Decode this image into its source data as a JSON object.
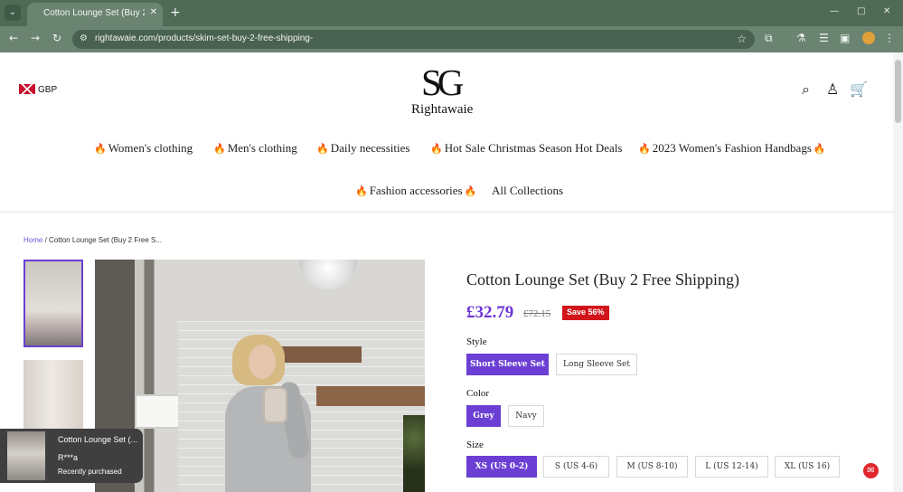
{
  "browser": {
    "tab_title": "Cotton Lounge Set (Buy 2 Free",
    "url": "rightawaie.com/products/skim-set-buy-2-free-shipping-"
  },
  "site": {
    "currency": "GBP",
    "logo_mark": "SG",
    "logo_text": "Rightawaie"
  },
  "menu": {
    "items": [
      "Women's clothing",
      "Men's clothing",
      "Daily necessities",
      "Hot Sale Christmas Season Hot Deals",
      "2023 Women's Fashion Handbags",
      "Fashion accessories",
      "All Collections"
    ]
  },
  "breadcrumb": {
    "home": "Home",
    "separator": "/",
    "current": "Cotton Lounge Set (Buy 2 Free S..."
  },
  "product": {
    "title": "Cotton Lounge Set (Buy 2 Free Shipping)",
    "price": "£32.79",
    "compare_price": "£72.15",
    "save": "Save 56%"
  },
  "options": {
    "style_label": "Style",
    "styles": [
      "Short Sleeve Set",
      "Long Sleeve Set"
    ],
    "color_label": "Color",
    "colors": [
      "Grey",
      "Navy"
    ],
    "size_label": "Size",
    "sizes": [
      "XS  (US 0-2)",
      "S  (US 4-6)",
      "M  (US 8-10)",
      "L  (US 12-14)",
      "XL  (US 16)"
    ]
  },
  "notification": {
    "title": "Cotton Lounge Set (...",
    "name": "R***a",
    "status": "Recently purchased"
  },
  "colors": {
    "accent": "#6b3fd4",
    "sale": "#d1161b",
    "browser": "#4f6a55"
  },
  "icons": {
    "search": "search-icon",
    "account": "user-icon",
    "cart": "cart-icon",
    "fire": "fire-icon"
  }
}
